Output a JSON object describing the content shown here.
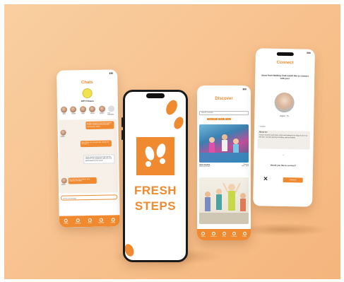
{
  "colors": {
    "background": "#f7c08c",
    "accent": "#ef8a30",
    "screen": "#ffffff"
  },
  "status": {
    "bars": "▮▮▮"
  },
  "chats": {
    "title": "Chats",
    "group_name": "WTT Fitness",
    "members": [
      {
        "name": "John"
      },
      {
        "name": "Claire"
      },
      {
        "name": "John"
      },
      {
        "name": "Joyce"
      },
      {
        "name": "Naomi"
      },
      {
        "name": "+37 members"
      }
    ],
    "messages": [
      {
        "sender": "",
        "text": "Is there anyone in the Slow Steps? There is parking at the Bromley community center!"
      },
      {
        "sender": "Claire",
        "text": ""
      },
      {
        "sender": "",
        "text": "Hey Claire, we can just ride outside for 10 mins :)"
      },
      {
        "sender": "",
        "text": "Does anyone know how intense this class is? I'm a beginner and am a bit intimidated by the name!"
      },
      {
        "sender": "Joyce",
        "text": "Do not fear, the class is very beginner friendly!"
      }
    ],
    "input_placeholder": "Send a message",
    "nav": [
      "Home",
      "Discover",
      "Chats",
      "Network",
      "Profile"
    ]
  },
  "splash": {
    "line1": "FRESH",
    "line2": "STEPS"
  },
  "discover": {
    "title": "Discover",
    "search_placeholder": "Search yourside...",
    "filters": [
      "Fitness (All)",
      "Cycle",
      "Yoga"
    ],
    "card1": {
      "title": "Aqua Zumba",
      "subtitle": "Forest Hill Pools",
      "right1": "Monday",
      "right2": "3pm - 4pm"
    },
    "nav": [
      "Home",
      "Discover",
      "Chats",
      "Network",
      "Profile"
    ]
  },
  "connect": {
    "title": "Connect",
    "prompt": "Joyce from Walking Club would like to connect with you!",
    "person_name": "Joyce, 75",
    "location": "London",
    "about_heading": "About me",
    "about_text": "I've just moved to south east London and looking for fun things to do in my free time. I've been learning to knitting, yoga and pilates.",
    "question": "Would you like to connect?",
    "decline_label": "✕",
    "connect_label": "Connect"
  }
}
